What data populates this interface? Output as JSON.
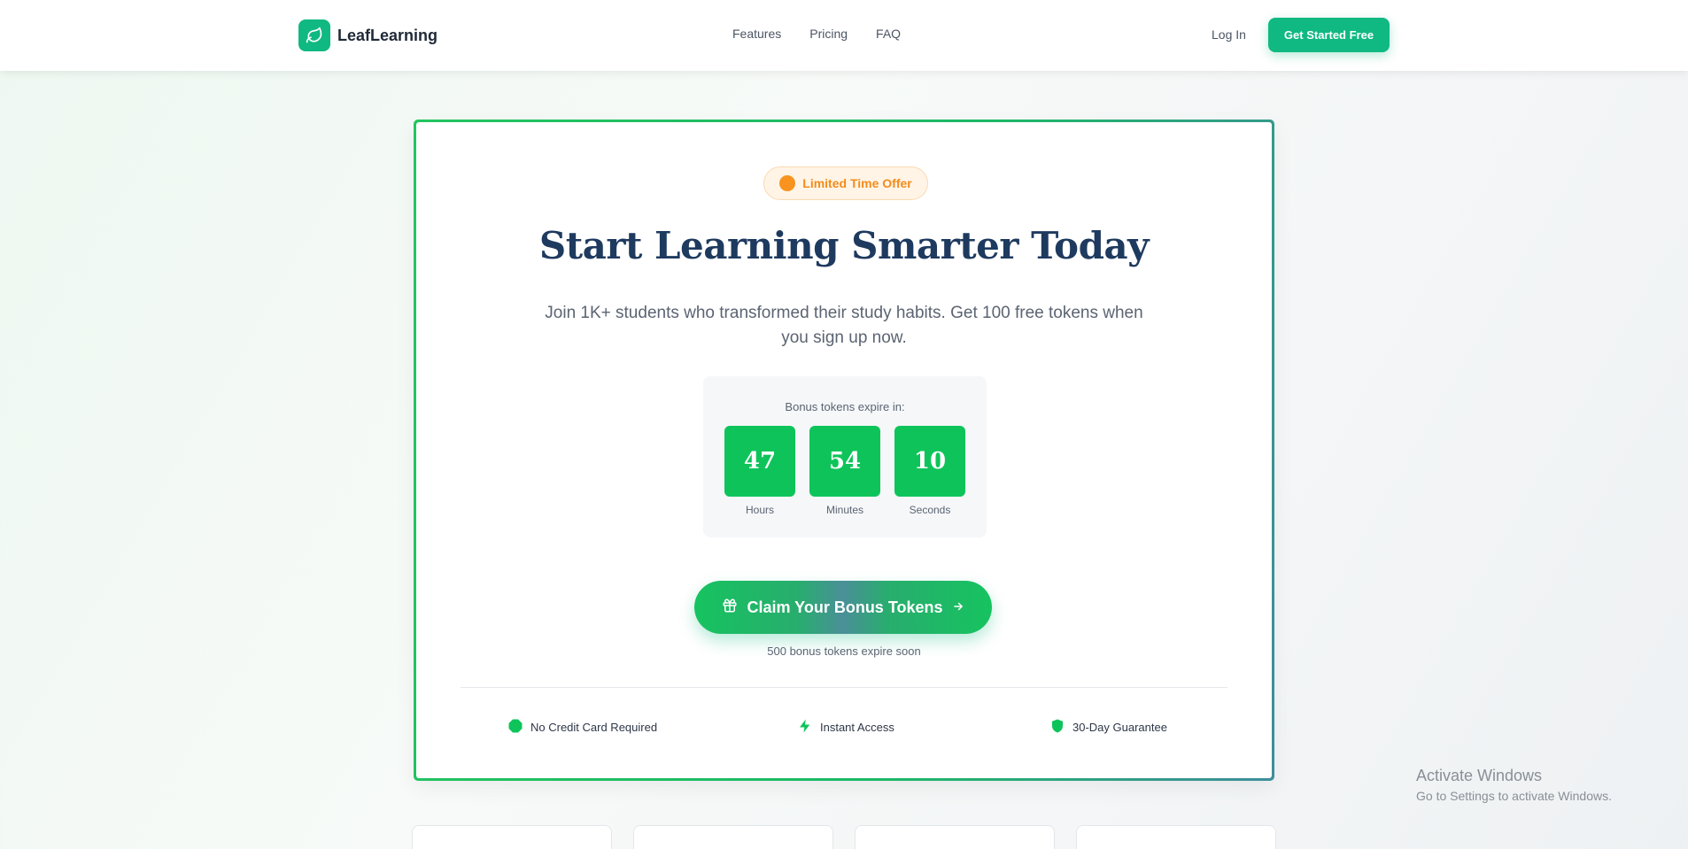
{
  "header": {
    "brand": "LeafLearning",
    "nav": [
      {
        "label": "Features"
      },
      {
        "label": "Pricing"
      },
      {
        "label": "FAQ"
      }
    ],
    "login_label": "Log In",
    "cta_label": "Get Started Free"
  },
  "hero": {
    "badge": "Limited Time Offer",
    "title": "Start Learning Smarter Today",
    "subtitle": "Join 1K+ students who transformed their study habits. Get 100 free tokens when you sign up now.",
    "timer": {
      "label": "Bonus tokens expire in:",
      "hours": "47",
      "hours_label": "Hours",
      "minutes": "54",
      "minutes_label": "Minutes",
      "seconds": "10",
      "seconds_label": "Seconds"
    },
    "claim_label": "Claim Your Bonus Tokens",
    "expire_note": "500 bonus tokens expire soon",
    "features": [
      {
        "label": "No Credit Card Required",
        "icon": "octagon-icon"
      },
      {
        "label": "Instant Access",
        "icon": "lightning-icon"
      },
      {
        "label": "30-Day Guarantee",
        "icon": "shield-icon"
      }
    ]
  },
  "watermark": {
    "line1": "Activate Windows",
    "line2": "Go to Settings to activate Windows."
  },
  "colors": {
    "brand": "#10b981",
    "accent_green": "#0ec45a",
    "heading": "#1e3a5f",
    "badge_orange": "#f28c1c"
  }
}
